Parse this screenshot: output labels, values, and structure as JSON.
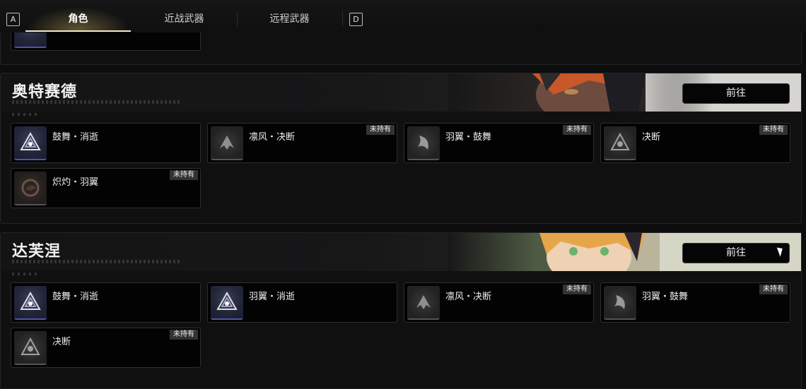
{
  "tabs": {
    "left_key": "A",
    "right_key": "D",
    "items": [
      {
        "label": "角色",
        "active": true
      },
      {
        "label": "近战武器",
        "active": false
      },
      {
        "label": "远程武器",
        "active": false
      }
    ]
  },
  "sections": [
    {
      "name": "奥特赛德",
      "goto_label": "前往",
      "items": [
        {
          "label": "鼓舞・消逝",
          "badge": ""
        },
        {
          "label": "凛风・决断",
          "badge": "未持有"
        },
        {
          "label": "羽翼・鼓舞",
          "badge": "未持有"
        },
        {
          "label": "决断",
          "badge": "未持有"
        },
        {
          "label": "炽灼・羽翼",
          "badge": "未持有"
        }
      ]
    },
    {
      "name": "达芙涅",
      "goto_label": "前往",
      "items": [
        {
          "label": "鼓舞・消逝",
          "badge": ""
        },
        {
          "label": "羽翼・消逝",
          "badge": ""
        },
        {
          "label": "凛风・决断",
          "badge": "未持有"
        },
        {
          "label": "羽翼・鼓舞",
          "badge": "未持有"
        },
        {
          "label": "决断",
          "badge": "未持有"
        }
      ]
    }
  ],
  "colors": {
    "accent_gold": "#c8aa5a",
    "icon_underline": "#4c56a8",
    "badge_bg": "#333334"
  }
}
